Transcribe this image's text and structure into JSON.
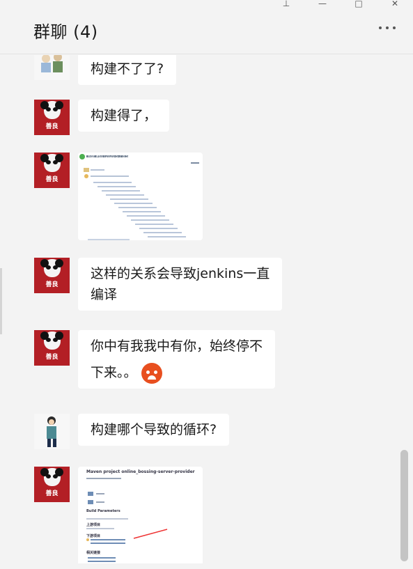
{
  "window": {
    "pin": "⊥",
    "minimize": "—",
    "maximize": "□",
    "close": "✕"
  },
  "header": {
    "title": "群聊 (4)"
  },
  "messages": [
    {
      "text": "构建不了了?"
    },
    {
      "text": "构建得了，"
    },
    {
      "image": "build-graph-screenshot"
    },
    {
      "text_line1": "这样的关系会导致jenkins一直",
      "text_line2": "编译"
    },
    {
      "text_line1": "你中有我我中有你，始终停不",
      "text_line2": "下来。。"
    },
    {
      "text": "构建哪个导致的循环?"
    },
    {
      "image": "maven-project-screenshot"
    }
  ],
  "avatar_label": "善良",
  "shot1": {
    "title": "构建 #60 (2020-5-7 8:53:47)"
  },
  "shot2": {
    "title": "Maven project online_bossing-server-provider",
    "section1": "Build Parameters",
    "section2": "上游项目",
    "section3": "下游项目",
    "section4": "相关链接"
  }
}
